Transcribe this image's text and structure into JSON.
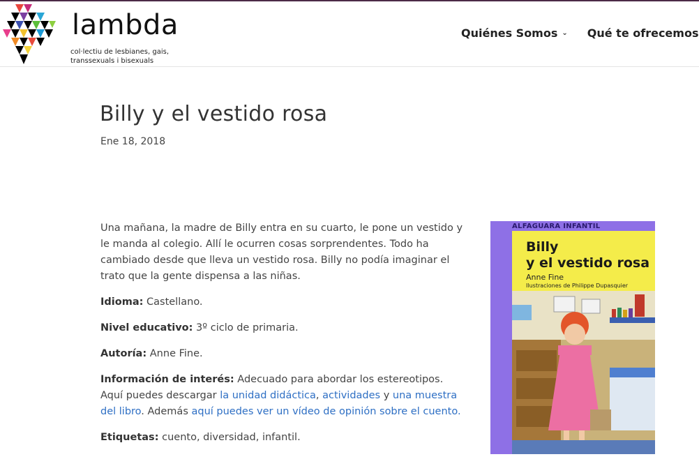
{
  "header": {
    "brand": "lambda",
    "tagline": "col·lectiu de lesbianes, gais, transsexuals i bisexuals",
    "nav": [
      {
        "label": "Quiénes Somos"
      },
      {
        "label": "Qué te ofrecemos"
      }
    ]
  },
  "post": {
    "title": "Billy y el vestido rosa",
    "date": "Ene 18, 2018",
    "summary": "Una mañana, la madre de Billy entra en su cuarto, le pone un vestido y le manda al colegio. Allí le ocurren cosas sorprendentes. Todo ha cambiado desde que lleva un vestido rosa. Billy no podía imaginar el trato que la gente dispensa a las niñas.",
    "idioma_label": "Idioma:",
    "idioma": " Castellano.",
    "nivel_label": "Nivel educativo:",
    "nivel": " 3º ciclo de primaria.",
    "autoria_label": "Autoría:",
    "autoria": " Anne Fine.",
    "info_label": "Información de interés:",
    "info_text1": " Adecuado para abordar los estereotipos. Aquí puedes descargar ",
    "link_unidad": "la unidad didáctica",
    "sep1": ", ",
    "link_actividades": "actividades",
    "sep2": " y ",
    "link_muestra": "una muestra del libro",
    "info_text2": ". Además ",
    "link_video": "aquí puedes ver un vídeo de opinión sobre el cuento.",
    "etiquetas_label": "Etiquetas:",
    "etiquetas": " cuento, diversidad, infantil."
  },
  "book": {
    "publisher": "ALFAGUARA INFANTIL",
    "title_line1": "Billy",
    "title_line2": "y el vestido rosa",
    "author": "Anne Fine",
    "illustrator": "Ilustraciones de Philippe Dupasquier"
  }
}
